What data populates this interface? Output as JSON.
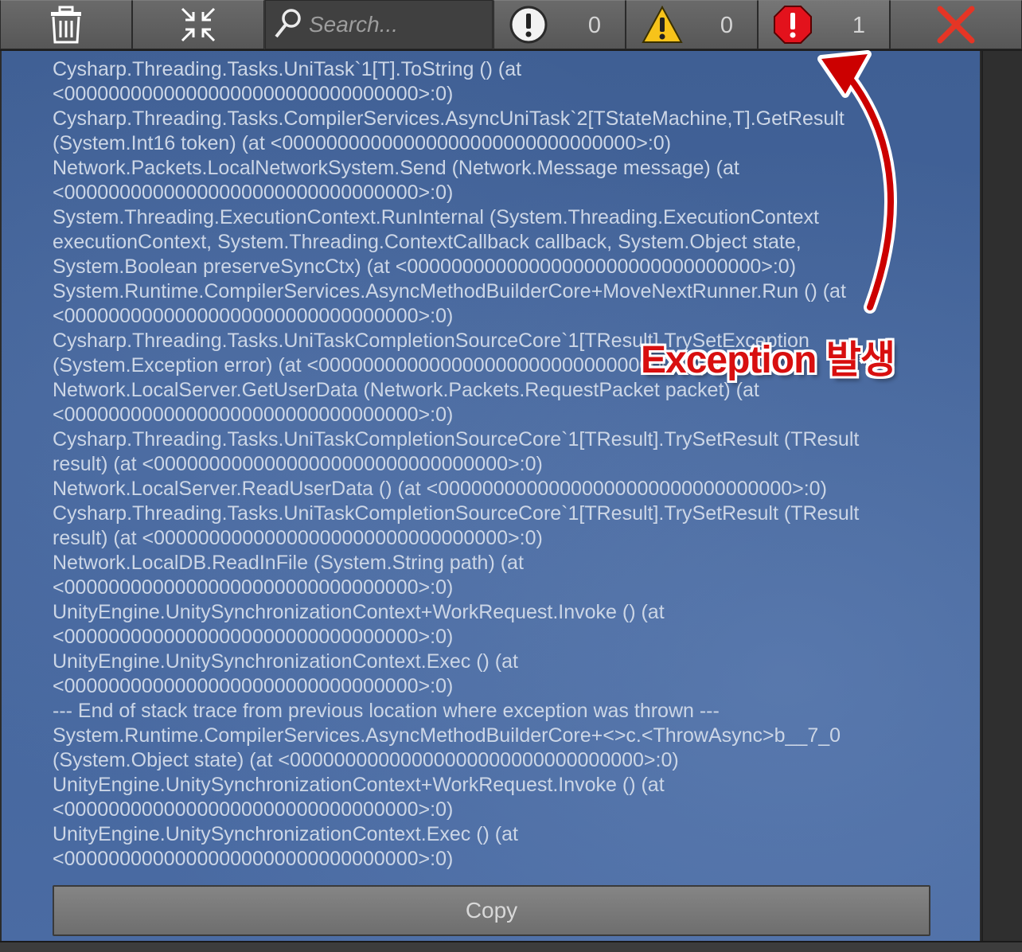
{
  "toolbar": {
    "clear_icon": "trash-icon",
    "collapse_icon": "collapse-arrows-icon",
    "search_placeholder": "Search...",
    "log_count": "0",
    "warning_count": "0",
    "error_count": "1",
    "close_icon": "close-icon"
  },
  "log": {
    "lines": [
      "Cysharp.Threading.Tasks.UniTask`1[T].ToString () (at",
      "<00000000000000000000000000000000>:0)",
      "Cysharp.Threading.Tasks.CompilerServices.AsyncUniTask`2[TStateMachine,T].GetResult",
      "(System.Int16 token) (at <00000000000000000000000000000000>:0)",
      "Network.Packets.LocalNetworkSystem.Send (Network.Message message) (at",
      "<00000000000000000000000000000000>:0)",
      "System.Threading.ExecutionContext.RunInternal (System.Threading.ExecutionContext",
      "executionContext, System.Threading.ContextCallback callback, System.Object state,",
      "System.Boolean preserveSyncCtx) (at <00000000000000000000000000000000>:0)",
      "System.Runtime.CompilerServices.AsyncMethodBuilderCore+MoveNextRunner.Run () (at",
      "<00000000000000000000000000000000>:0)",
      "Cysharp.Threading.Tasks.UniTaskCompletionSourceCore`1[TResult].TrySetException",
      "(System.Exception error) (at <00000000000000000000000000000000>:0)",
      "Network.LocalServer.GetUserData (Network.Packets.RequestPacket packet) (at",
      "<00000000000000000000000000000000>:0)",
      "Cysharp.Threading.Tasks.UniTaskCompletionSourceCore`1[TResult].TrySetResult (TResult",
      "result) (at <00000000000000000000000000000000>:0)",
      "Network.LocalServer.ReadUserData () (at <00000000000000000000000000000000>:0)",
      "Cysharp.Threading.Tasks.UniTaskCompletionSourceCore`1[TResult].TrySetResult (TResult",
      "result) (at <00000000000000000000000000000000>:0)",
      "Network.LocalDB.ReadInFile (System.String path) (at",
      "<00000000000000000000000000000000>:0)",
      "UnityEngine.UnitySynchronizationContext+WorkRequest.Invoke () (at",
      "<00000000000000000000000000000000>:0)",
      "UnityEngine.UnitySynchronizationContext.Exec () (at",
      "<00000000000000000000000000000000>:0)",
      "--- End of stack trace from previous location where exception was thrown ---",
      "System.Runtime.CompilerServices.AsyncMethodBuilderCore+<>c.<ThrowAsync>b__7_0",
      "(System.Object state) (at <00000000000000000000000000000000>:0)",
      "UnityEngine.UnitySynchronizationContext+WorkRequest.Invoke () (at",
      "<00000000000000000000000000000000>:0)",
      "UnityEngine.UnitySynchronizationContext.Exec () (at",
      "<00000000000000000000000000000000>:0)"
    ]
  },
  "copy_button": {
    "label": "Copy"
  },
  "annotation": {
    "text": "Exception 발생",
    "color": "#d80f0f"
  }
}
